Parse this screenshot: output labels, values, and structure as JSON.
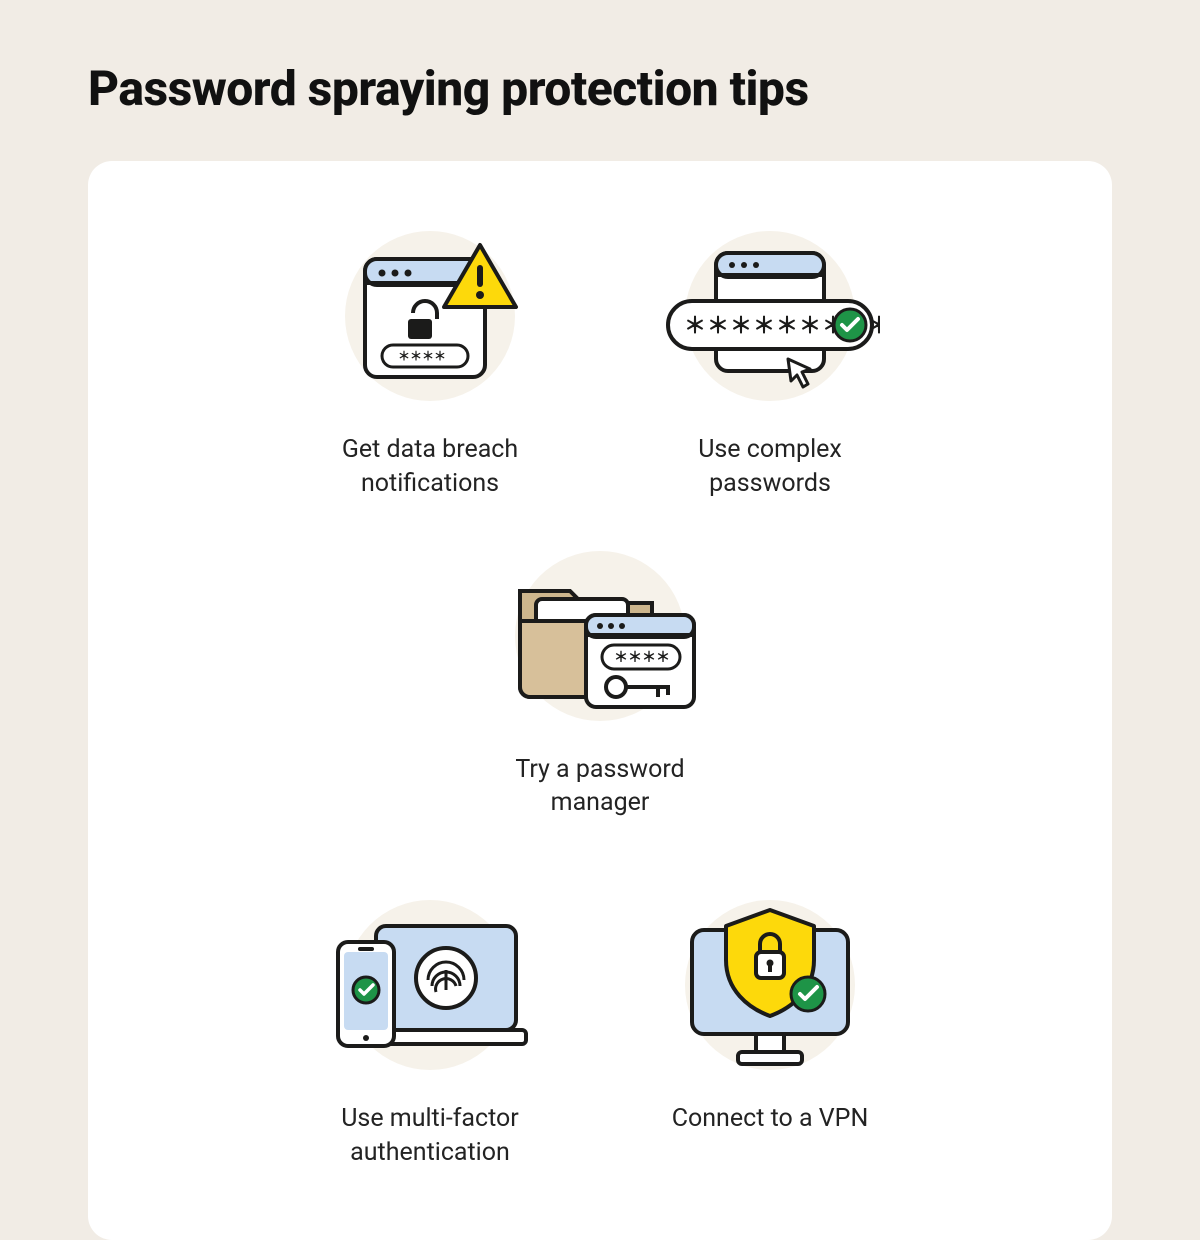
{
  "title": "Password spraying protection tips",
  "tips": [
    {
      "id": "breach-notifications",
      "caption": "Get data breach notifications",
      "icon": "alert-browser-icon"
    },
    {
      "id": "complex-passwords",
      "caption": "Use complex passwords",
      "icon": "password-field-icon"
    },
    {
      "id": "password-manager",
      "caption": "Try a password manager",
      "icon": "folder-key-icon"
    },
    {
      "id": "mfa",
      "caption": "Use multi-factor authentication",
      "icon": "laptop-phone-fingerprint-icon"
    },
    {
      "id": "vpn",
      "caption": "Connect to a VPN",
      "icon": "monitor-shield-icon"
    }
  ],
  "colors": {
    "background": "#f1ece5",
    "card": "#ffffff",
    "halo": "#f6f2ea",
    "stroke": "#1b1b1a",
    "accentBlue": "#c7dbf2",
    "accentYellow": "#fdd90b",
    "accentGreen": "#1e9447",
    "accentTan": "#d7c09a"
  }
}
